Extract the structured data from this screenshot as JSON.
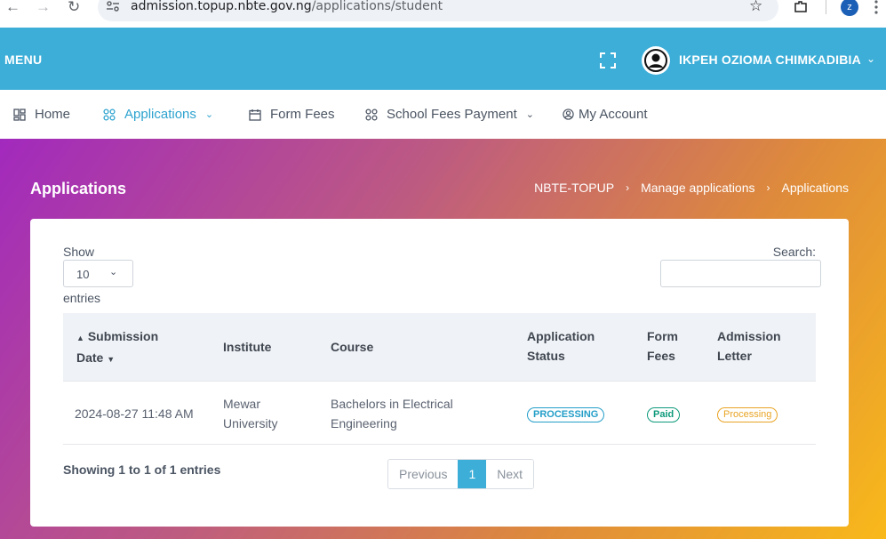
{
  "browser": {
    "url_host": "admission.topup.nbte.gov.ng",
    "url_path": "/applications/student",
    "profile_initial": "z"
  },
  "topbar": {
    "menu_label": "MENU",
    "user_name": "IKPEH OZIOMA CHIMKADIBIA",
    "accent_color": "#3daed8"
  },
  "nav": {
    "home": "Home",
    "applications": "Applications",
    "form_fees": "Form Fees",
    "school_fees": "School Fees Payment",
    "my_account": "My Account"
  },
  "page": {
    "title": "Applications",
    "breadcrumb": [
      "NBTE-TOPUP",
      "Manage applications",
      "Applications"
    ]
  },
  "table_controls": {
    "show_label": "Show",
    "page_length": "10",
    "entries_label": "entries",
    "search_label": "Search:"
  },
  "table": {
    "columns": {
      "date_line1": "Submission",
      "date_line2": "Date",
      "institute": "Institute",
      "course": "Course",
      "status_line1": "Application",
      "status_line2": "Status",
      "fees_line1": "Form",
      "fees_line2": "Fees",
      "letter_line1": "Admission",
      "letter_line2": "Letter"
    },
    "rows": [
      {
        "date": "2024-08-27 11:48 AM",
        "institute_line1": "Mewar",
        "institute_line2": "University",
        "course_line1": "Bachelors in Electrical",
        "course_line2": "Engineering",
        "status": "PROCESSING",
        "form_fees": "Paid",
        "admission_letter": "Processing"
      }
    ]
  },
  "footer": {
    "info": "Showing 1 to 1 of 1 entries",
    "prev": "Previous",
    "current_page": "1",
    "next": "Next"
  }
}
